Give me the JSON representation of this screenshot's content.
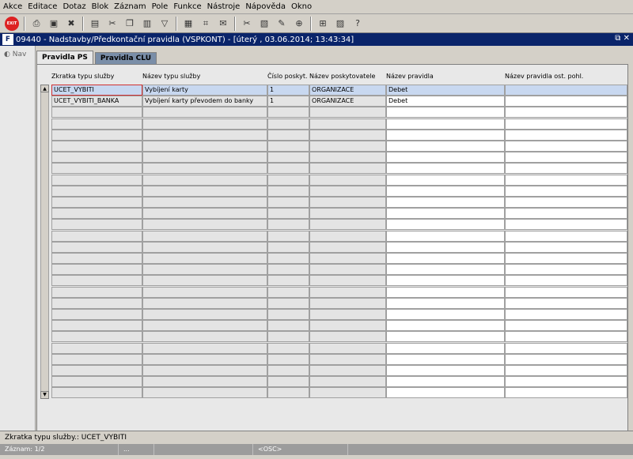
{
  "menu": [
    "Akce",
    "Editace",
    "Dotaz",
    "Blok",
    "Záznam",
    "Pole",
    "Funkce",
    "Nástroje",
    "Nápověda",
    "Okno"
  ],
  "toolbar_icons": [
    "exit-icon",
    "print-icon",
    "save-icon",
    "delete-icon",
    "folder-icon",
    "cut-icon",
    "copy-icon",
    "paste-icon",
    "filter-icon",
    "calculator-icon",
    "attachment-icon",
    "mail-icon",
    "scissors-icon",
    "clipboard-icon",
    "compose-icon",
    "zoom-icon",
    "split-icon",
    "fax-icon",
    "help-icon"
  ],
  "window": {
    "title": "09440 - Nadstavby/Předkontační pravidla (VSPKONT) - [úterý , 03.06.2014; 13:43:34]",
    "nav_label": "Nav"
  },
  "tabs": [
    "Pravidla PS",
    "Pravidla CLU"
  ],
  "table": {
    "headers": [
      "Zkratka typu služby",
      "Název typu služby",
      "Číslo poskyt.",
      "Název poskytovatele",
      "Název pravidla",
      "Název pravidla ost. pohl."
    ],
    "rows": [
      [
        "UCET_VYBITI",
        "Vybíjení karty",
        "1",
        "ORGANIZACE",
        "Debet",
        ""
      ],
      [
        "UCET_VYBITI_BANKA",
        "Vybíjení karty převodem do banky",
        "1",
        "ORGANIZACE",
        "Debet",
        ""
      ]
    ],
    "total_rows": 28
  },
  "status": {
    "field": "Zkratka typu služby.: UCET_VYBITI",
    "record": "Záznam: 1/2",
    "seg2": "...",
    "seg3": "",
    "osc": "<OSC>"
  }
}
